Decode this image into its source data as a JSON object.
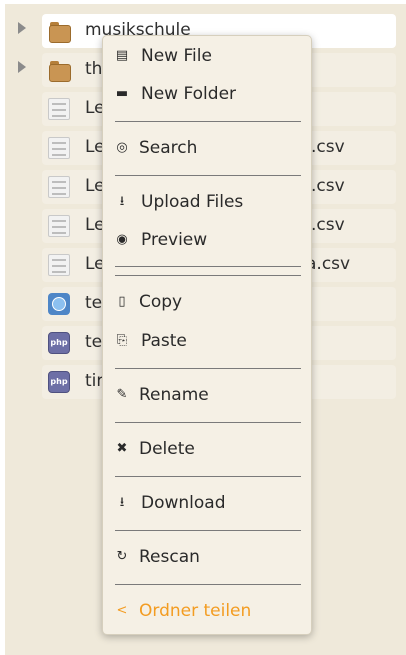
{
  "file_list": {
    "rows": [
      {
        "type": "folder",
        "icon": "folder-icon",
        "name": "musikschule",
        "suffix": "",
        "expandable": true,
        "selected": true
      },
      {
        "type": "folder",
        "icon": "folder-icon",
        "name": "th",
        "suffix": "",
        "expandable": true,
        "selected": false
      },
      {
        "type": "doc",
        "icon": "document-icon",
        "name": "Le",
        "suffix": "",
        "expandable": false,
        "selected": false
      },
      {
        "type": "doc",
        "icon": "document-icon",
        "name": "Le",
        "suffix": ".csv",
        "expandable": false,
        "selected": false
      },
      {
        "type": "doc",
        "icon": "document-icon",
        "name": "Le",
        "suffix": ".csv",
        "expandable": false,
        "selected": false
      },
      {
        "type": "doc",
        "icon": "document-icon",
        "name": "Le",
        "suffix": ".csv",
        "expandable": false,
        "selected": false
      },
      {
        "type": "doc",
        "icon": "document-icon",
        "name": "Le",
        "suffix": "a.csv",
        "expandable": false,
        "selected": false
      },
      {
        "type": "web",
        "icon": "globe-icon",
        "name": "te",
        "suffix": "",
        "expandable": false,
        "selected": false
      },
      {
        "type": "php",
        "icon": "php-icon",
        "name": "te",
        "suffix": "",
        "expandable": false,
        "selected": false
      },
      {
        "type": "php",
        "icon": "php-icon",
        "name": "tir",
        "suffix": "",
        "expandable": false,
        "selected": false
      }
    ],
    "php_badge": "php"
  },
  "context_menu": {
    "items": {
      "new_file": {
        "label": "New File",
        "icon": "new-file-icon",
        "glyph": "▤"
      },
      "new_folder": {
        "label": "New Folder",
        "icon": "folder-icon",
        "glyph": "▬"
      },
      "search": {
        "label": "Search",
        "icon": "search-icon",
        "glyph": "◎"
      },
      "upload": {
        "label": "Upload Files",
        "icon": "upload-icon",
        "glyph": "⭳"
      },
      "preview": {
        "label": "Preview",
        "icon": "eye-icon",
        "glyph": "◉"
      },
      "copy": {
        "label": "Copy",
        "icon": "copy-icon",
        "glyph": "▯"
      },
      "paste": {
        "label": "Paste",
        "icon": "paste-icon",
        "glyph": "⎘"
      },
      "rename": {
        "label": "Rename",
        "icon": "pencil-icon",
        "glyph": "✎"
      },
      "delete": {
        "label": "Delete",
        "icon": "delete-icon",
        "glyph": "✖"
      },
      "download": {
        "label": "Download",
        "icon": "download-icon",
        "glyph": "⭳"
      },
      "rescan": {
        "label": "Rescan",
        "icon": "refresh-icon",
        "glyph": "↻"
      },
      "share": {
        "label": "Ordner teilen",
        "icon": "share-icon",
        "glyph": "<"
      }
    }
  },
  "colors": {
    "panel_bg": "#efe9da",
    "menu_bg": "#f5f0e5",
    "share_accent": "#f39c21"
  }
}
